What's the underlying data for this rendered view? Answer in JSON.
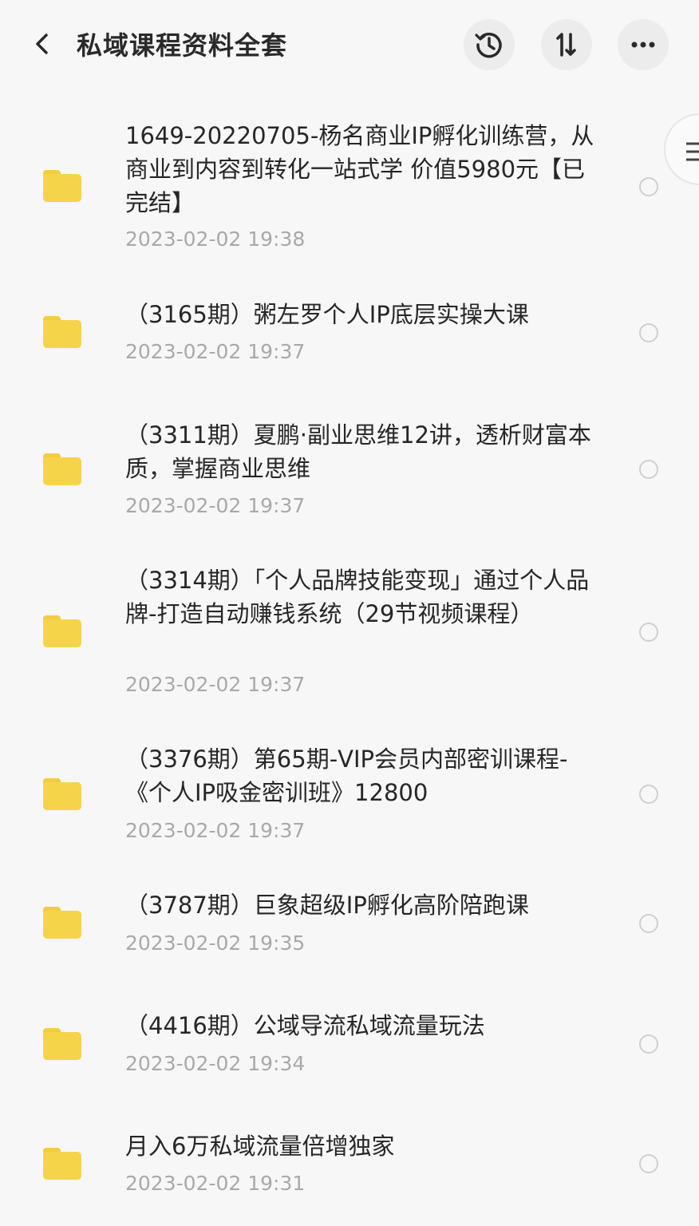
{
  "header": {
    "title": "私域课程资料全套",
    "back_icon": "chevron-left-icon",
    "history_icon": "history-icon",
    "sort_label": "1↓",
    "more_label": "•••"
  },
  "files": [
    {
      "name": "1649-20220705-杨名商业IP孵化训练营，从商业到内容到转化一站式学 价值5980元【已完结】",
      "date": "2023-02-02  19:38"
    },
    {
      "name": "（3165期）粥左罗个人IP底层实操大课",
      "date": "2023-02-02  19:37"
    },
    {
      "name": "（3311期）夏鹏·副业思维12讲，透析财富本质，掌握商业思维",
      "date": "2023-02-02  19:37"
    },
    {
      "name": "（3314期）「个人品牌技能变现」通过个人品牌-打造自动赚钱系统（29节视频课程）",
      "date": "2023-02-02  19:37"
    },
    {
      "name": "（3376期）第65期-VIP会员内部密训课程-《个人IP吸金密训班》12800",
      "date": "2023-02-02  19:37"
    },
    {
      "name": "（3787期）巨象超级IP孵化高阶陪跑课",
      "date": "2023-02-02  19:35"
    },
    {
      "name": "（4416期）公域导流私域流量玩法",
      "date": "2023-02-02  19:34"
    },
    {
      "name": "月入6万私域流量倍增独家",
      "date": "2023-02-02  19:31"
    }
  ],
  "colors": {
    "folder": "#f6d44a",
    "date_text": "#a9a9a9",
    "background": "#f7f7f7"
  }
}
